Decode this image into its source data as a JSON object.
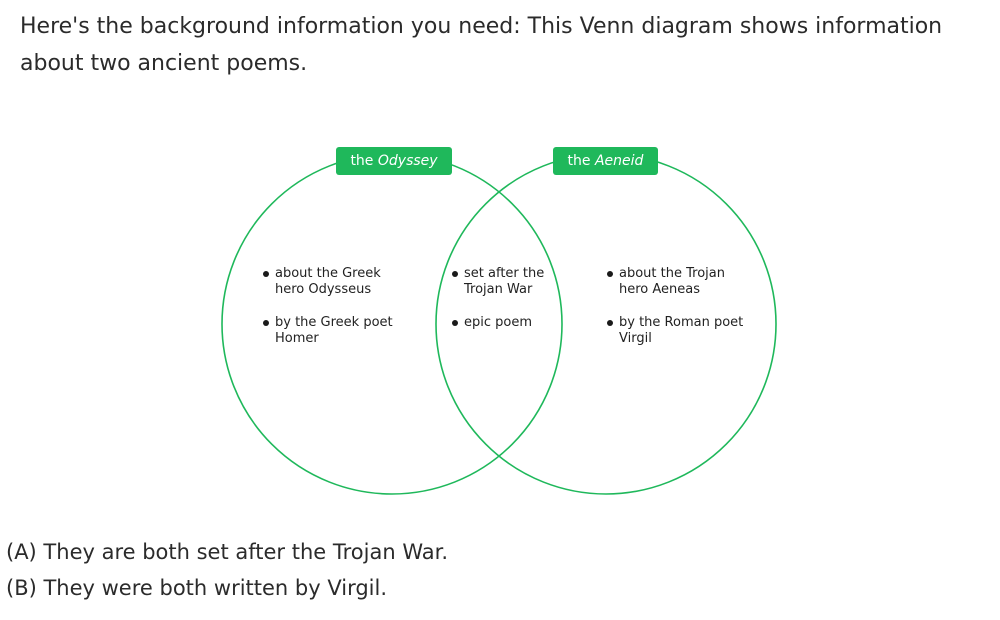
{
  "intro_text": "Here's the background information you need: This Venn diagram shows information about two ancient poems.",
  "colors": {
    "circle_stroke": "#1fb85b",
    "label_fill": "#1fb85b",
    "label_text": "#ffffff"
  },
  "venn": {
    "left_label": {
      "prefix": "the ",
      "title": "Odyssey"
    },
    "right_label": {
      "prefix": "the ",
      "title": "Aeneid"
    },
    "left_only": [
      "about the Greek hero Odysseus",
      "by the Greek poet Homer"
    ],
    "both": [
      "set after the Trojan War",
      "epic poem"
    ],
    "right_only": [
      "about the Trojan hero Aeneas",
      "by the Roman poet Virgil"
    ]
  },
  "choices": [
    "(A) They are both set after the Trojan War.",
    "(B) They were both written by Virgil."
  ]
}
